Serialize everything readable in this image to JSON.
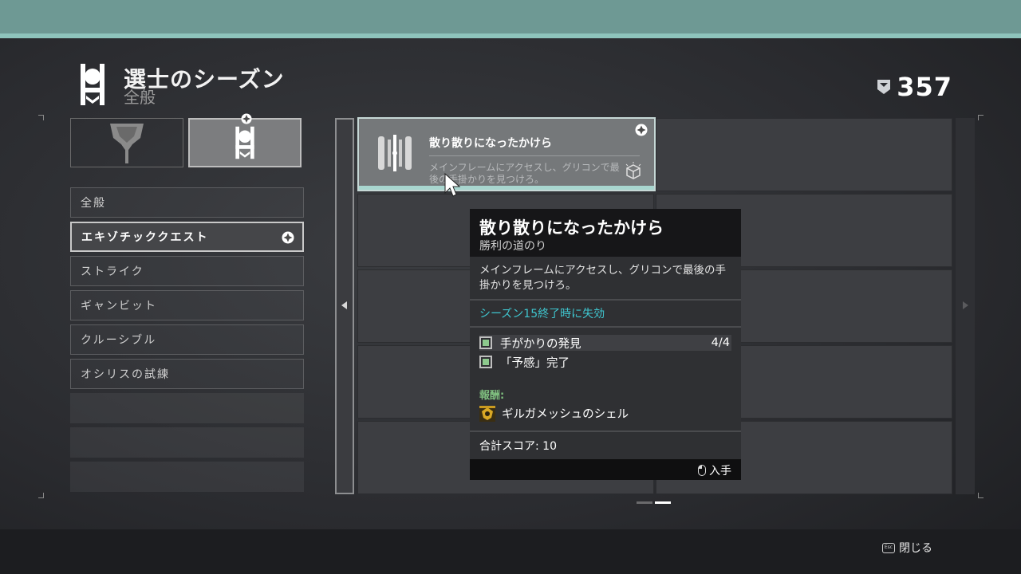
{
  "header": {
    "title": "選士のシーズン",
    "subtitle": "全般",
    "currency_value": "357"
  },
  "categories": [
    {
      "name": "vanguard-emblem"
    },
    {
      "name": "season-emblem",
      "active": true
    }
  ],
  "menu": {
    "items": [
      {
        "label": "全般"
      },
      {
        "label": "エキゾチッククエスト",
        "active": true
      },
      {
        "label": "ストライク"
      },
      {
        "label": "ギャンビット"
      },
      {
        "label": "クルーシブル"
      },
      {
        "label": "オシリスの試練"
      }
    ]
  },
  "quest_card": {
    "name": "散り散りになったかけら",
    "description": "メインフレームにアクセスし、グリコンで最後の手掛かりを見つけろ。"
  },
  "tooltip": {
    "title": "散り散りになったかけら",
    "subtitle": "勝利の道のり",
    "description": "メインフレームにアクセスし、グリコンで最後の手掛かりを見つけろ。",
    "expiry": "シーズン15終了時に失効",
    "objectives": [
      {
        "label": "手がかりの発見",
        "progress": "4/4",
        "complete": true
      },
      {
        "label": "「予感」完了",
        "progress": "",
        "complete": true
      }
    ],
    "rewards_header": "報酬:",
    "reward": "ギルガメッシュのシェル",
    "score": "合計スコア: 10",
    "action": "入手"
  },
  "pager": {
    "pages": 2,
    "current": 2
  },
  "footer": {
    "close_label": "閉じる",
    "close_key": "Esc"
  },
  "colors": {
    "top_bar": "#6e9994",
    "accent_teal": "#3fc6cf",
    "reward_green": "#7fbf7f",
    "complete_green": "#8dc98d"
  }
}
